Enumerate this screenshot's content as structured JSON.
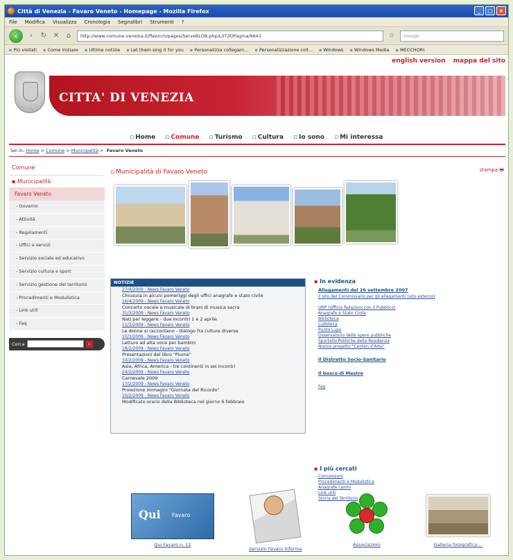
{
  "window": {
    "title": "Città di Venezia - Favaro Veneto - Homepage - Mozilla Firefox"
  },
  "menu": [
    "File",
    "Modifica",
    "Visualizza",
    "Cronologia",
    "Segnalibri",
    "Strumenti",
    "?"
  ],
  "toolbar": {
    "url": "http://www.comune.venezia.it/flex/cm/pages/ServeBLOB.php/L/IT/IDPagina/9641",
    "search_placeholder": "Google"
  },
  "bookmarks": [
    "Più visitati",
    "Come iniziare",
    "Ultime notizie",
    "Let them sing it for you",
    "Personalizza collegam...",
    "Personalizzazione coll...",
    "Windows",
    "Windows Media",
    "MECCHORI"
  ],
  "site": {
    "english": "english version",
    "sitemap": "mappa del sito",
    "title": "CITTA' DI VENEZIA"
  },
  "topnav": [
    {
      "label": "Home",
      "active": false
    },
    {
      "label": "Comune",
      "active": true
    },
    {
      "label": "Turismo",
      "active": false
    },
    {
      "label": "Cultura",
      "active": false
    },
    {
      "label": "Io sono",
      "active": false
    },
    {
      "label": "Mi interessa",
      "active": false
    }
  ],
  "breadcrumb": {
    "prefix": "Sei in:",
    "items": [
      "Home",
      "Comune",
      "Municipalità"
    ],
    "current": "Favaro Veneto"
  },
  "sidebar": {
    "title": "Comune",
    "sub": "Municipalità",
    "current": "Favaro Veneto",
    "items": [
      "Governo",
      "Attività",
      "Regolamenti",
      "Uffici e servizi",
      "Servizio sociale ed educativo",
      "Servizio cultura e sport",
      "Servizio gestione del territorio",
      "Procedimenti e Modulistica",
      "Link utili",
      "Faq"
    ],
    "search_label": "Cerca"
  },
  "main": {
    "title": "Municipalità di Favaro Veneto",
    "print": "stampa"
  },
  "news": {
    "title": "NOTIZIE",
    "items": [
      {
        "date": "27/4/2009 - News Favaro Veneto",
        "text": "Chiusura in alcuni pomeriggi degli uffici anagrafe e stato civile"
      },
      {
        "date": "16/4/2009 - News Favaro Veneto",
        "text": "Concerto vocale e musicale di brani di musica sacra"
      },
      {
        "date": "31/3/2009 - News Favaro Veneto",
        "text": "Nati per leggere - due incontri 1 e 2 aprile"
      },
      {
        "date": "11/3/2009 - News Favaro Veneto",
        "text": "Le donne si raccontano - dialogo fra culture diverse"
      },
      {
        "date": "10/3/2009 - News Favaro Veneto",
        "text": "Letture ad alta voce per bambini"
      },
      {
        "date": "18/2/2009 - News Favaro Veneto",
        "text": "Presentazioni del libro \"Piume\""
      },
      {
        "date": "10/2/2009 - News Favaro Veneto",
        "text": "Asia, Africa, America - tre continenti in sei incontri"
      },
      {
        "date": "24/2/2009 - News Favaro Veneto",
        "text": "Carnevale 2009"
      },
      {
        "date": "17/2/2009 - News Favaro Veneto",
        "text": "Proiezione immagini \"Giornata del Ricordo\""
      },
      {
        "date": "10/2/2009 - News Favaro Veneto",
        "text": "Modificato orario della Biblioteca nel giorno 6 febbraio"
      }
    ]
  },
  "evidenza": {
    "title": "In evidenza",
    "headline": "Allagamenti del 26 settembre 2007",
    "headline_link": "Il sito del Commissario per gli allagamenti (sito esterno)",
    "links": [
      "URP (Ufficio Relazioni con il Pubblico)",
      "Anagrafe e Stato Civile",
      "Biblioteca",
      "Ludoteca",
      "Punto Lupo",
      "Osservatorio delle opere pubbliche",
      "Sportello Politiche della Residenza",
      "Nuovo progetto \"Centen d'Arte\""
    ],
    "distretto": "Il Distretto Socio-Sanitario",
    "bosco": "Il bosco di Mestre",
    "faq": "Faq"
  },
  "cercati": {
    "title": "I più cercati",
    "links": [
      "Concessioni",
      "Procedimenti e Modulistica",
      "Anagrafe canini",
      "Link utili",
      "Storia del Territorio"
    ]
  },
  "footer": {
    "items": [
      "Qui Favaro n. 12",
      "Servizio Favaro Informa",
      "Associazioni",
      "Galleria fotografica ..."
    ],
    "qui_logo": "Qui",
    "qui_sub": "Favaro"
  }
}
